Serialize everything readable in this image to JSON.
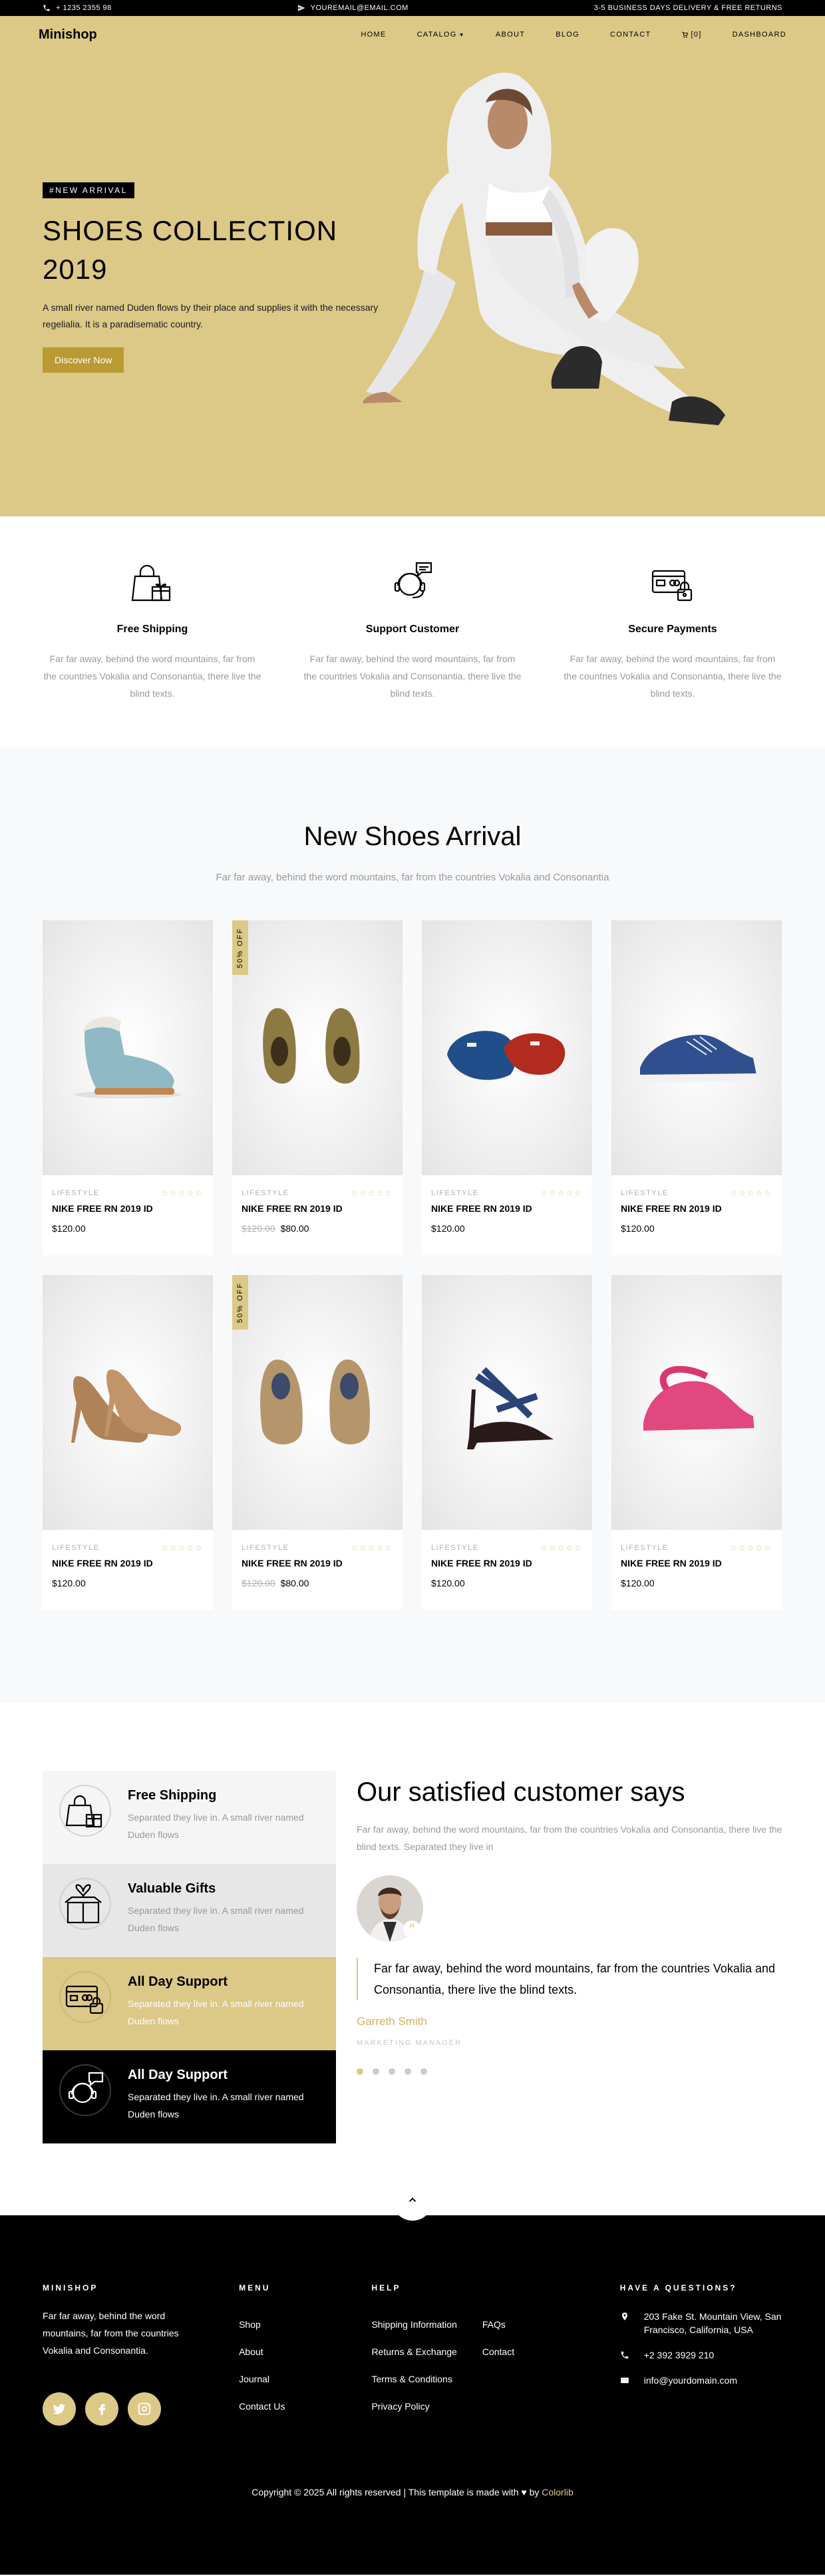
{
  "topbar": {
    "phone": "+ 1235 2355 98",
    "email": "YOUREMAIL@EMAIL.COM",
    "promo": "3-5 BUSINESS DAYS DELIVERY & FREE RETURNS"
  },
  "nav": {
    "brand": "Minishop",
    "items": [
      {
        "label": "HOME"
      },
      {
        "label": "CATALOG"
      },
      {
        "label": "ABOUT"
      },
      {
        "label": "BLOG"
      },
      {
        "label": "CONTACT"
      },
      {
        "label": "[0]"
      },
      {
        "label": "DASHBOARD"
      }
    ]
  },
  "hero": {
    "badge": "#NEW ARRIVAL",
    "title_line1": "SHOES COLLECTION",
    "title_line2": "2019",
    "subtitle": "A small river named Duden flows by their place and supplies it with the necessary regelialia. It is a paradisematic country.",
    "cta": "Discover Now"
  },
  "features": [
    {
      "icon": "shopping-bag-icon",
      "title": "Free Shipping",
      "text": "Far far away, behind the word mountains, far from the countries Vokalia and Consonantia, there live the blind texts."
    },
    {
      "icon": "support-icon",
      "title": "Support Customer",
      "text": "Far far away, behind the word mountains, far from the countries Vokalia and Consonantia, there live the blind texts."
    },
    {
      "icon": "credit-card-lock-icon",
      "title": "Secure Payments",
      "text": "Far far away, behind the word mountains, far from the countries Vokalia and Consonantia, there live the blind texts."
    }
  ],
  "arrivals": {
    "title": "New Shoes Arrival",
    "subtitle": "Far far away, behind the word mountains, far from the countries Vokalia and Consonantia",
    "products": [
      {
        "image": "teal-boot",
        "tag": "",
        "category": "LIFESTYLE",
        "name": "NIKE FREE RN 2019 ID",
        "old_price": "",
        "price": "$120.00"
      },
      {
        "image": "khaki-boot",
        "tag": "50% OFF",
        "category": "LIFESTYLE",
        "name": "NIKE FREE RN 2019 ID",
        "old_price": "$120.00",
        "price": "$80.00"
      },
      {
        "image": "loafers",
        "tag": "",
        "category": "LIFESTYLE",
        "name": "NIKE FREE RN 2019 ID",
        "old_price": "",
        "price": "$120.00"
      },
      {
        "image": "blue-sneaker",
        "tag": "",
        "category": "LIFESTYLE",
        "name": "NIKE FREE RN 2019 ID",
        "old_price": "",
        "price": "$120.00"
      },
      {
        "image": "nude-heels",
        "tag": "",
        "category": "LIFESTYLE",
        "name": "NIKE FREE RN 2019 ID",
        "old_price": "",
        "price": "$120.00"
      },
      {
        "image": "canvas-sneaker",
        "tag": "50% OFF",
        "category": "LIFESTYLE",
        "name": "NIKE FREE RN 2019 ID",
        "old_price": "$120.00",
        "price": "$80.00"
      },
      {
        "image": "strappy-heels",
        "tag": "",
        "category": "LIFESTYLE",
        "name": "NIKE FREE RN 2019 ID",
        "old_price": "",
        "price": "$120.00"
      },
      {
        "image": "pink-sneaker",
        "tag": "",
        "category": "LIFESTYLE",
        "name": "NIKE FREE RN 2019 ID",
        "old_price": "",
        "price": "$120.00"
      }
    ]
  },
  "services": [
    {
      "icon": "shopping-bag-icon",
      "title": "Free Shipping",
      "text": "Separated they live in. A small river named Duden flows"
    },
    {
      "icon": "gift-icon",
      "title": "Valuable Gifts",
      "text": "Separated they live in. A small river named Duden flows"
    },
    {
      "icon": "credit-card-lock-icon",
      "title": "All Day Support",
      "text": "Separated they live in. A small river named Duden flows"
    },
    {
      "icon": "support-icon",
      "title": "All Day Support",
      "text": "Separated they live in. A small river named Duden flows"
    }
  ],
  "testimonial": {
    "title": "Our satisfied customer says",
    "lead": "Far far away, behind the word mountains, far from the countries Vokalia and Consonantia, there live the blind texts. Separated they live in",
    "quote": "Far far away, behind the word mountains, far from the countries Vokalia and Consonantia, there live the blind texts.",
    "name": "Garreth Smith",
    "role": "MARKETING MANAGER",
    "slides": 5,
    "active_slide": 1
  },
  "footer": {
    "brand": "MINISHOP",
    "about": "Far far away, behind the word mountains, far from the countries Vokalia and Consonantia.",
    "menu_title": "MENU",
    "menu": [
      "Shop",
      "About",
      "Journal",
      "Contact Us"
    ],
    "help_title": "HELP",
    "help_col1": [
      "Shipping Information",
      "Returns & Exchange",
      "Terms & Conditions",
      "Privacy Policy"
    ],
    "help_col2": [
      "FAQs",
      "Contact"
    ],
    "contact_title": "HAVE A QUESTIONS?",
    "address": "203 Fake St. Mountain View, San Francisco, California, USA",
    "phone": "+2 392 3929 210",
    "email": "info@yourdomain.com",
    "copyright_pre": "Copyright © 2025 All rights reserved | This template is made with",
    "copyright_by": "by",
    "copyright_link": "Colorlib"
  },
  "colors": {
    "accent": "#dcc887",
    "hero_bg": "#dcc887",
    "button": "#b99a33",
    "footer_bg": "#000000"
  }
}
